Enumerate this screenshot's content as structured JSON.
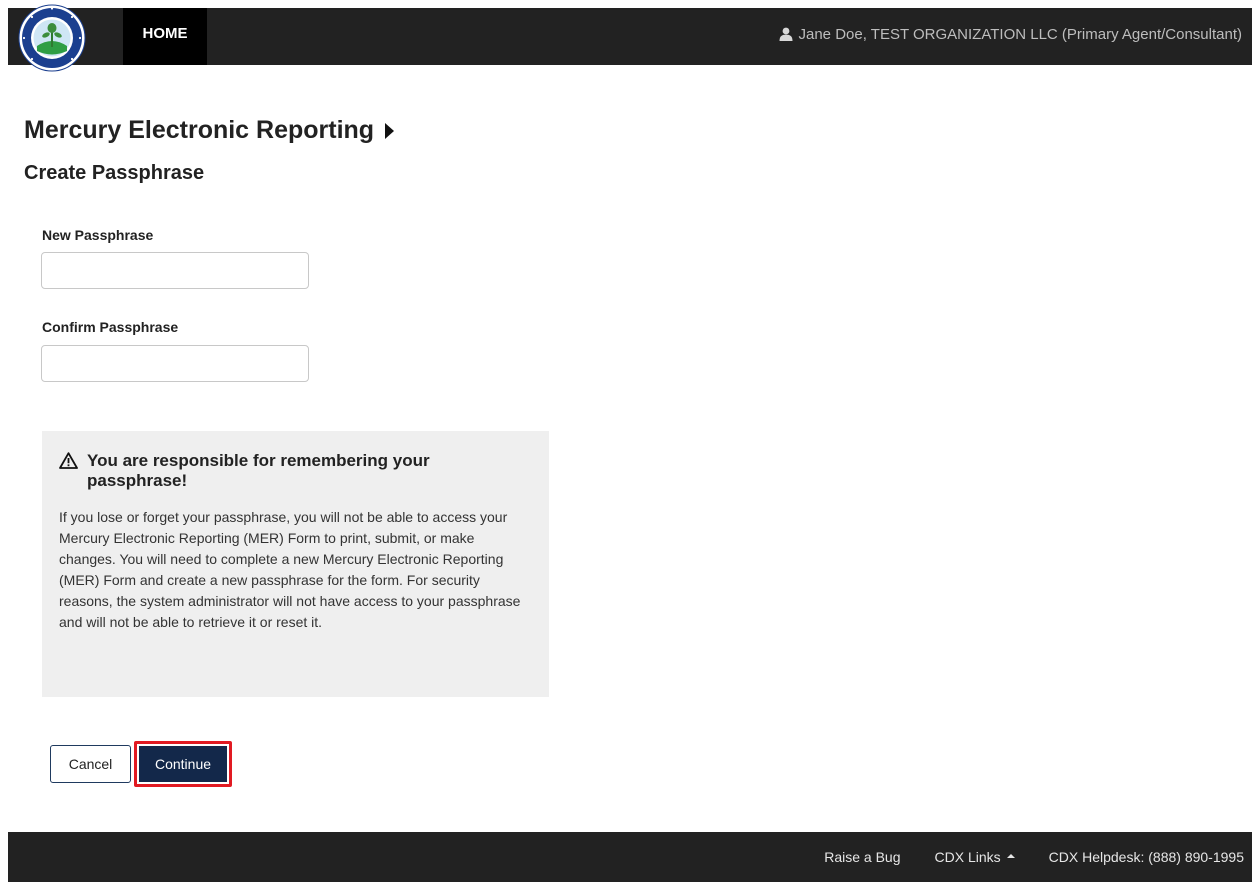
{
  "header": {
    "home_label": "HOME",
    "user_label": "Jane Doe, TEST ORGANIZATION LLC (Primary Agent/Consultant)",
    "logo_icon": "epa-seal-logo",
    "user_icon": "user-icon"
  },
  "page": {
    "app_title": "Mercury Electronic Reporting",
    "section_title": "Create Passphrase"
  },
  "form": {
    "new_label": "New Passphrase",
    "new_value": "",
    "confirm_label": "Confirm Passphrase",
    "confirm_value": ""
  },
  "warning": {
    "icon": "warning-triangle-icon",
    "heading": "You are responsible for remembering your passphrase!",
    "body": "If you lose or forget your passphrase, you will not be able to access your Mercury Electronic Reporting (MER) Form to print, submit, or make changes. You will need to complete a new Mercury Electronic Reporting (MER) Form and create a new passphrase for the form. For security reasons, the system administrator will not have access to your passphrase and will not be able to retrieve it or reset it."
  },
  "actions": {
    "cancel_label": "Cancel",
    "continue_label": "Continue"
  },
  "footer": {
    "raise_bug": "Raise a Bug",
    "cdx_links": "CDX Links",
    "helpdesk": "CDX Helpdesk: (888) 890-1995"
  },
  "colors": {
    "topbar": "#222222",
    "primary_button": "#13284a",
    "highlight_border": "#e11a22",
    "warning_bg": "#efefef"
  }
}
